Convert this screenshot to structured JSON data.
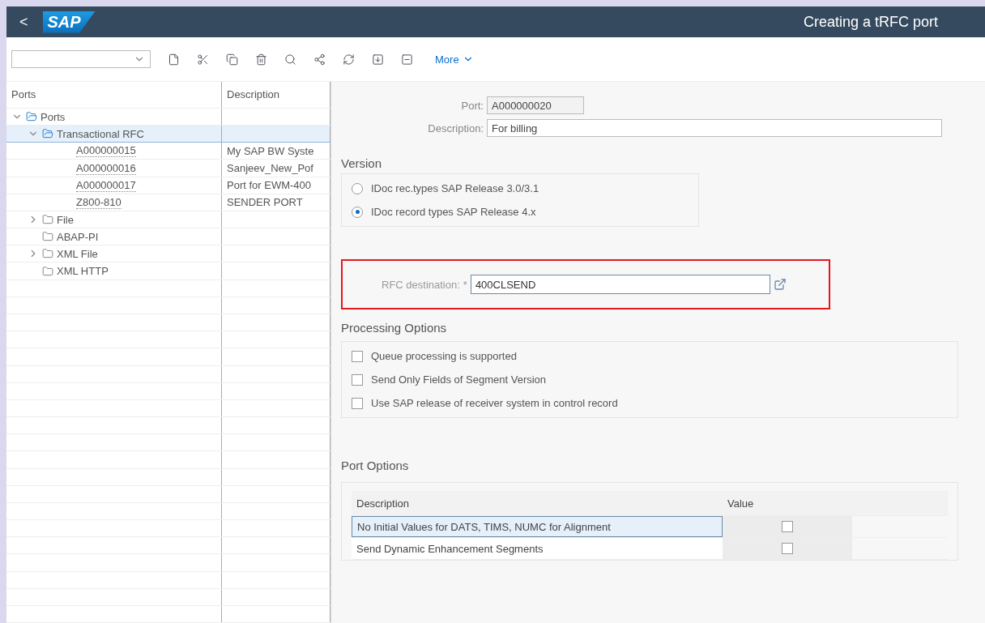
{
  "header": {
    "back": "<",
    "logo": "SAP",
    "title": "Creating a tRFC port"
  },
  "toolbar": {
    "more": "More"
  },
  "tree": {
    "columns": [
      "Ports",
      "Description"
    ],
    "items": [
      {
        "kind": "folder",
        "label": "Ports",
        "expanded": true,
        "selected": false,
        "children": [
          {
            "kind": "folder",
            "label": "Transactional RFC",
            "expanded": true,
            "selected": true,
            "children": [
              {
                "kind": "port",
                "label": "A000000015",
                "description": "My SAP BW Syste",
                "selected": false
              },
              {
                "kind": "port",
                "label": "A000000016",
                "description": "Sanjeev_New_Pof",
                "selected": false
              },
              {
                "kind": "port",
                "label": "A000000017",
                "description": "Port for EWM-400",
                "selected": false
              },
              {
                "kind": "port",
                "label": "Z800-810",
                "description": "SENDER PORT",
                "selected": false
              }
            ]
          },
          {
            "kind": "folder",
            "label": "File",
            "expanded": false,
            "selected": false
          },
          {
            "kind": "folder",
            "label": "ABAP-PI",
            "selected": false
          },
          {
            "kind": "folder",
            "label": "XML File",
            "expanded": false,
            "selected": false
          },
          {
            "kind": "folder",
            "label": "XML HTTP",
            "selected": false
          }
        ]
      }
    ]
  },
  "form": {
    "port": {
      "label": "Port:",
      "value": "A000000020"
    },
    "description": {
      "label": "Description:",
      "value": "For billing"
    },
    "version": {
      "title": "Version",
      "options": [
        {
          "label": "IDoc rec.types SAP Release 3.0/3.1",
          "selected": false
        },
        {
          "label": "IDoc record types SAP Release 4.x",
          "selected": true
        }
      ]
    },
    "rfc": {
      "label": "RFC destination:",
      "required": "*",
      "value": "400CLSEND"
    },
    "processing": {
      "title": "Processing Options",
      "options": [
        {
          "label": "Queue processing is supported",
          "checked": false
        },
        {
          "label": "Send Only Fields of Segment Version",
          "checked": false
        },
        {
          "label": "Use SAP release of receiver system in control record",
          "checked": false
        }
      ]
    },
    "port_options": {
      "title": "Port Options",
      "columns": [
        "Description",
        "Value"
      ],
      "rows": [
        {
          "description": "No Initial Values for DATS, TIMS, NUMC for Alignment",
          "checked": false,
          "selected": true
        },
        {
          "description": "Send Dynamic Enhancement Segments",
          "checked": false,
          "selected": false
        }
      ]
    }
  }
}
